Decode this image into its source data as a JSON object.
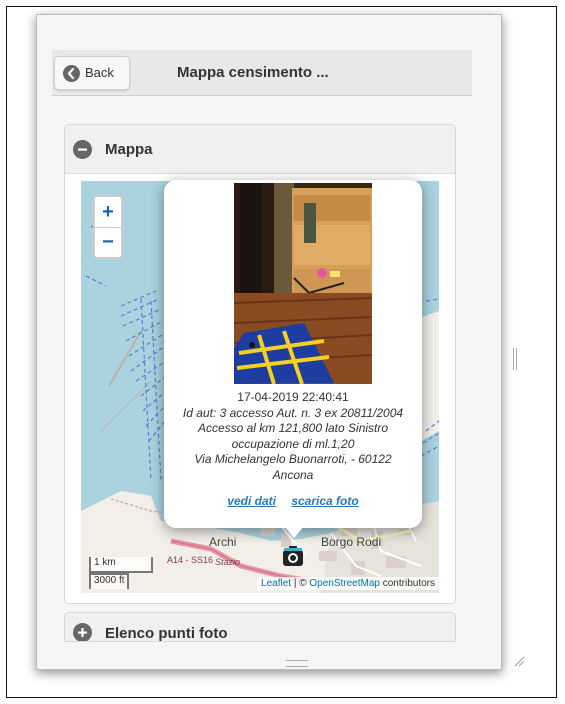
{
  "header": {
    "back_label": "Back",
    "title": "Mappa censimento ..."
  },
  "map_section": {
    "title": "Mappa",
    "zoom_in": "+",
    "zoom_out": "−",
    "scale_km": "1 km",
    "scale_ft": "3000 ft",
    "labels": {
      "archi": "Archi",
      "borgo_rodi": "Borgo Rodi",
      "road_code": "A14 - SS16",
      "stazione": "Stazio"
    },
    "attribution": {
      "leaflet": "Leaflet",
      "separator": " | © ",
      "osm": "OpenStreetMap",
      "contributors": " contributors"
    }
  },
  "popup": {
    "timestamp": "17-04-2019 22:40:41",
    "id_line": "Id aut: 3 accesso Aut. n. 3 ex 20811/2004",
    "desc_line1": "Accesso al km 121,800 lato Sinistro",
    "desc_line2": "occupazione di ml.1,20",
    "address_line1": "Via Michelangelo Buonarroti, - 60122",
    "address_line2": "Ancona",
    "link_data": "vedi dati",
    "link_photo": "scarica foto"
  },
  "next_section": {
    "title": "Elenco punti foto"
  },
  "icons": {
    "back": "arrow-left-circle-icon",
    "collapse": "minus-circle-icon",
    "expand": "plus-circle-icon",
    "layers": "layers-icon",
    "marker": "camera-icon"
  },
  "colors": {
    "water": "#aad3df",
    "link": "#2a78c2",
    "zoom": "#1565c0"
  }
}
